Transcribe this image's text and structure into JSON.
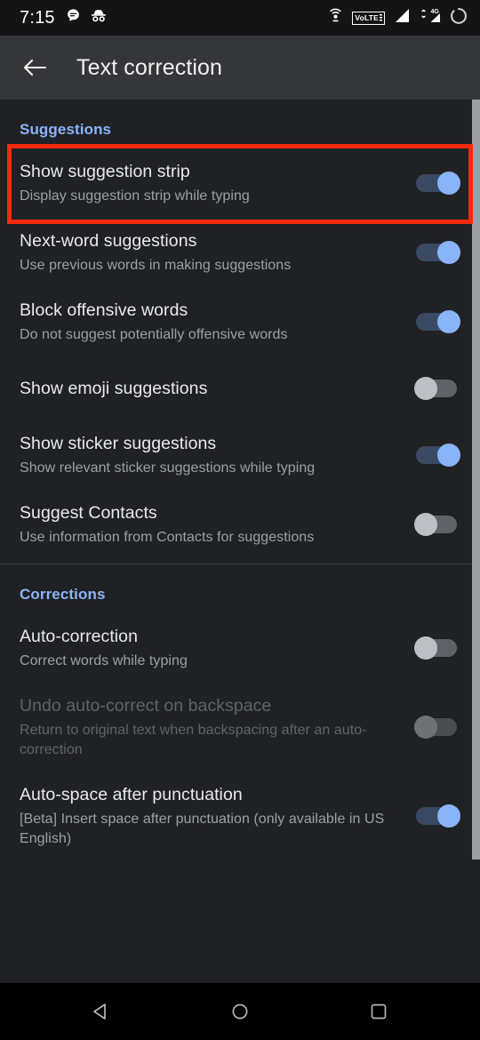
{
  "status_bar": {
    "time": "7:15",
    "left_icons": [
      "message-bubble-icon",
      "incognito-icon"
    ],
    "right_icons": [
      "hotspot-icon",
      "volte-icon",
      "signal-icon",
      "signal-4g-icon",
      "loading-spinner-icon"
    ],
    "volte_label": "VoLTE",
    "network_label": "4G"
  },
  "app_bar": {
    "back_icon": "back-arrow-icon",
    "title": "Text correction"
  },
  "colors": {
    "accent_blue": "#8ab4f8",
    "highlight_red": "#f5290c",
    "switch_on_track": "#3a4a63",
    "switch_off_track": "#5f6368",
    "background": "#202124",
    "appbar_background": "#35363a"
  },
  "sections": [
    {
      "header": "Suggestions",
      "items": [
        {
          "title": "Show suggestion strip",
          "subtitle": "Display suggestion strip while typing",
          "toggle": "on",
          "disabled": false,
          "highlighted": true
        },
        {
          "title": "Next-word suggestions",
          "subtitle": "Use previous words in making suggestions",
          "toggle": "on",
          "disabled": false,
          "highlighted": false
        },
        {
          "title": "Block offensive words",
          "subtitle": "Do not suggest potentially offensive words",
          "toggle": "on",
          "disabled": false,
          "highlighted": false
        },
        {
          "title": "Show emoji suggestions",
          "subtitle": "",
          "toggle": "off",
          "disabled": false,
          "highlighted": false
        },
        {
          "title": "Show sticker suggestions",
          "subtitle": "Show relevant sticker suggestions while typing",
          "toggle": "on",
          "disabled": false,
          "highlighted": false
        },
        {
          "title": "Suggest Contacts",
          "subtitle": "Use information from Contacts for suggestions",
          "toggle": "off",
          "disabled": false,
          "highlighted": false
        }
      ]
    },
    {
      "header": "Corrections",
      "items": [
        {
          "title": "Auto-correction",
          "subtitle": "Correct words while typing",
          "toggle": "off",
          "disabled": false,
          "highlighted": false
        },
        {
          "title": "Undo auto-correct on backspace",
          "subtitle": "Return to original text when backspacing after an auto-correction",
          "toggle": "off",
          "disabled": true,
          "highlighted": false
        },
        {
          "title": "Auto-space after punctuation",
          "subtitle": "[Beta] Insert space after punctuation (only available in US English)",
          "toggle": "on",
          "disabled": false,
          "highlighted": false
        }
      ]
    }
  ],
  "nav_bar": {
    "back": "nav-back-icon",
    "home": "nav-home-icon",
    "recents": "nav-recents-icon"
  }
}
